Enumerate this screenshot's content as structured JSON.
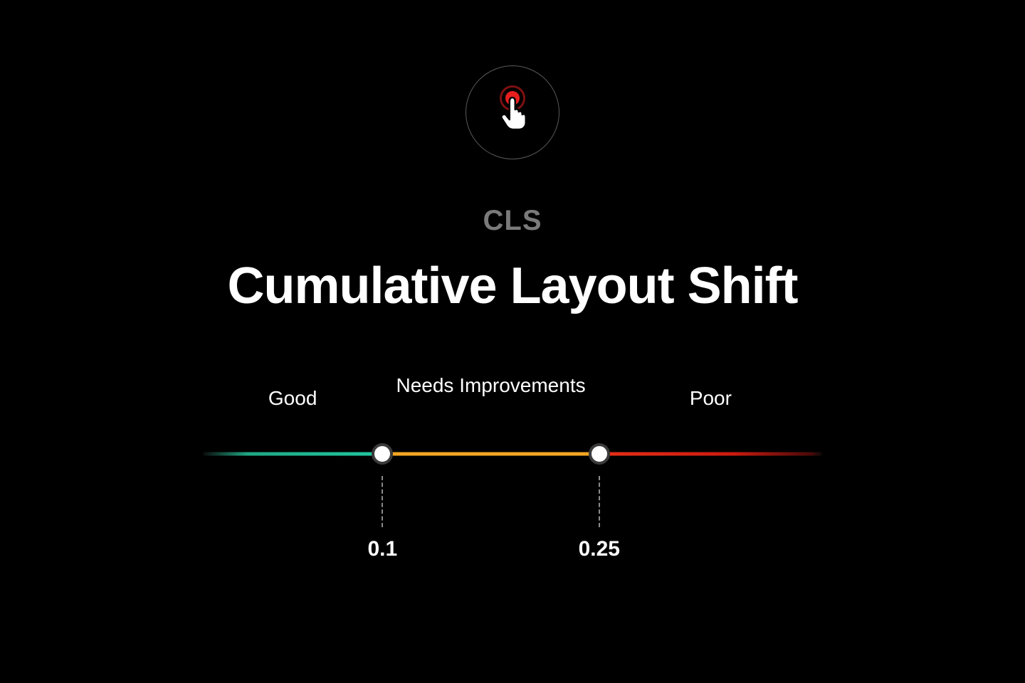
{
  "header": {
    "abbrev": "CLS",
    "title": "Cumulative Layout Shift"
  },
  "scale": {
    "labels": {
      "good": "Good",
      "mid": "Needs Improvements",
      "poor": "Poor"
    },
    "thresholds": {
      "first": "0.1",
      "second": "0.25"
    },
    "colors": {
      "good": "#1fc9a0",
      "mid": "#f5a623",
      "poor": "#e63018"
    }
  },
  "icon": {
    "name": "tap-pointer-icon",
    "accent": "#e61e1e"
  }
}
